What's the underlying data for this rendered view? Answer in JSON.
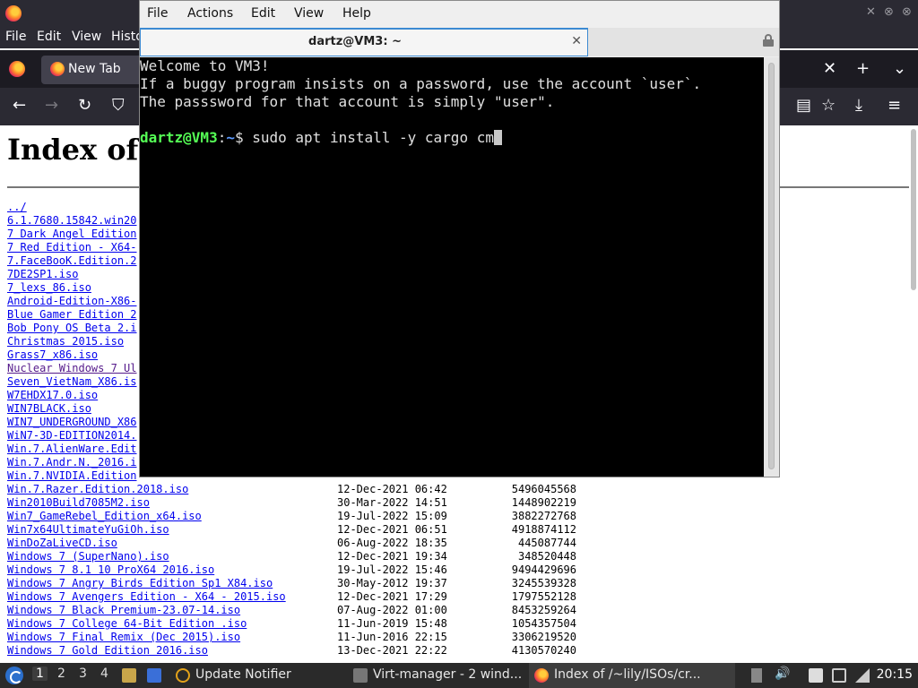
{
  "firefox": {
    "menu": [
      "File",
      "Edit",
      "View",
      "Histo"
    ],
    "tab_label": "New Tab",
    "page_heading": "Index of",
    "listing": [
      {
        "name": "../",
        "date": "",
        "size": ""
      },
      {
        "name": "6.1.7680.15842.win20",
        "date": "",
        "size": ""
      },
      {
        "name": "7 Dark Angel Edition",
        "date": "",
        "size": ""
      },
      {
        "name": "7 Red Edition - X64-",
        "date": "",
        "size": ""
      },
      {
        "name": "7.FaceBooK.Edition.2",
        "date": "",
        "size": ""
      },
      {
        "name": "7DE2SP1.iso",
        "date": "",
        "size": ""
      },
      {
        "name": "7_lexs_86.iso",
        "date": "",
        "size": ""
      },
      {
        "name": "Android-Edition-X86-",
        "date": "",
        "size": ""
      },
      {
        "name": "Blue Gamer Edition 2",
        "date": "",
        "size": ""
      },
      {
        "name": "Bob Pony OS Beta 2.i",
        "date": "",
        "size": ""
      },
      {
        "name": "Christmas 2015.iso",
        "date": "",
        "size": ""
      },
      {
        "name": "Grass7_x86.iso",
        "date": "",
        "size": ""
      },
      {
        "name": "Nuclear Windows 7 Ul",
        "date": "",
        "size": "",
        "visited": true
      },
      {
        "name": "Seven_VietNam_X86.is",
        "date": "",
        "size": ""
      },
      {
        "name": "W7EHDX17.0.iso",
        "date": "",
        "size": ""
      },
      {
        "name": "WIN7BLACK.iso",
        "date": "",
        "size": ""
      },
      {
        "name": "WIN7_UNDERGROUND_X86",
        "date": "",
        "size": ""
      },
      {
        "name": "WiN7-3D-EDITION2014.",
        "date": "",
        "size": ""
      },
      {
        "name": "Win.7.AlienWare.Edit",
        "date": "",
        "size": ""
      },
      {
        "name": "Win.7.Andr.N._2016.i",
        "date": "",
        "size": ""
      },
      {
        "name": "Win.7.NVIDIA.Edition",
        "date": "",
        "size": ""
      },
      {
        "name": "Win.7.Razer.Edition.2018.iso",
        "date": "12-Dec-2021 06:42",
        "size": "5496045568"
      },
      {
        "name": "Win2010Build7085M2.iso",
        "date": "30-Mar-2022 14:51",
        "size": "1448902219"
      },
      {
        "name": "Win7_GameRebel_Edition_x64.iso",
        "date": "19-Jul-2022 15:09",
        "size": "3882272768"
      },
      {
        "name": "Win7x64UltimateYuGiOh.iso",
        "date": "12-Dec-2021 06:51",
        "size": "4918874112"
      },
      {
        "name": "WinDoZaLiveCD.iso",
        "date": "06-Aug-2022 18:35",
        "size": "445087744"
      },
      {
        "name": "Windows 7 (SuperNano).iso",
        "date": "12-Dec-2021 19:34",
        "size": "348520448"
      },
      {
        "name": "Windows 7 8.1 10  ProX64 2016.iso",
        "date": "19-Jul-2022 15:46",
        "size": "9494429696"
      },
      {
        "name": "Windows 7 Angry Birds Edition Sp1 X84.iso",
        "date": "30-May-2012 19:37",
        "size": "3245539328"
      },
      {
        "name": "Windows 7 Avengers Edition - X64 - 2015.iso",
        "date": "12-Dec-2021 17:29",
        "size": "1797552128"
      },
      {
        "name": "Windows 7 Black Premium-23.07-14.iso",
        "date": "07-Aug-2022 01:00",
        "size": "8453259264"
      },
      {
        "name": "Windows 7 College 64-Bit Edition .iso",
        "date": "11-Jun-2019 15:48",
        "size": "1054357504"
      },
      {
        "name": "Windows 7 Final Remix (Dec 2015).iso",
        "date": "11-Jun-2016 22:15",
        "size": "3306219520"
      },
      {
        "name": "Windows 7 Gold Edition 2016.iso",
        "date": "13-Dec-2021 22:22",
        "size": "4130570240"
      }
    ]
  },
  "terminal": {
    "menu": [
      "File",
      "Actions",
      "Edit",
      "View",
      "Help"
    ],
    "tab_title": "dartz@VM3: ~",
    "motd": [
      "Welcome to VM3!",
      "If a buggy program insists on a password, use the account `user`.",
      "The passsword for that account is simply \"user\"."
    ],
    "prompt_user": "dartz@VM3",
    "prompt_sep": ":",
    "prompt_path": "~",
    "prompt_symbol": "$ ",
    "command": "sudo apt install -y cargo cm"
  },
  "taskbar": {
    "workspaces": [
      "1",
      "2",
      "3",
      "4"
    ],
    "tasks": [
      "Update Notifier",
      "Virt-manager - 2 wind...",
      "Index of /~lily/ISOs/cr..."
    ],
    "clock": "20:15"
  }
}
